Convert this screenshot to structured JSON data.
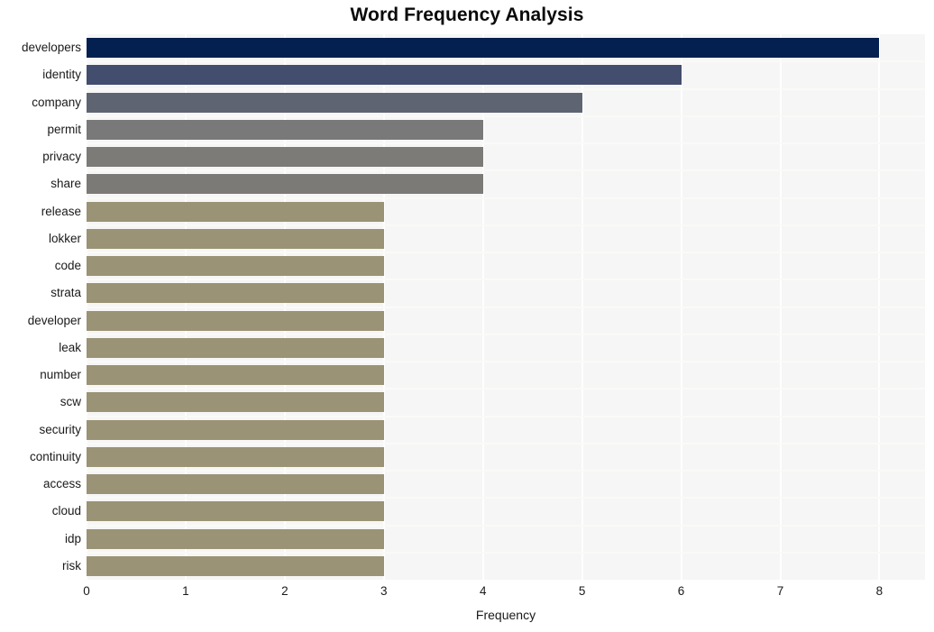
{
  "chart_data": {
    "type": "bar",
    "orientation": "horizontal",
    "title": "Word Frequency Analysis",
    "xlabel": "Frequency",
    "ylabel": "",
    "xlim": [
      0,
      8.46
    ],
    "xticks": [
      0,
      1,
      2,
      3,
      4,
      5,
      6,
      7,
      8
    ],
    "xtick_labels": [
      "0",
      "1",
      "2",
      "3",
      "4",
      "5",
      "6",
      "7",
      "8"
    ],
    "grid": "vertical-white-on-gray",
    "legend": "none",
    "categories": [
      "developers",
      "identity",
      "company",
      "permit",
      "privacy",
      "share",
      "release",
      "lokker",
      "code",
      "strata",
      "developer",
      "leak",
      "number",
      "scw",
      "security",
      "continuity",
      "access",
      "cloud",
      "idp",
      "risk"
    ],
    "values": [
      8,
      6,
      5,
      4,
      4,
      4,
      3,
      3,
      3,
      3,
      3,
      3,
      3,
      3,
      3,
      3,
      3,
      3,
      3,
      3
    ],
    "bar_colors": [
      "#042050",
      "#434d6d",
      "#5f6472",
      "#797979",
      "#7c7b78",
      "#7b7a76",
      "#9a9375",
      "#9a9375",
      "#9a9375",
      "#9a9375",
      "#9a9375",
      "#9a9375",
      "#9a9375",
      "#9a9375",
      "#9a9375",
      "#9a9375",
      "#9a9375",
      "#9a9375",
      "#9a9375",
      "#9a9375"
    ]
  },
  "style": {
    "plot_background": "#f6f6f6",
    "figure_background": "#ffffff",
    "gridline_color": "#ffffff",
    "text_color": "#1a1a1a",
    "title_color": "#0a0a0a"
  }
}
